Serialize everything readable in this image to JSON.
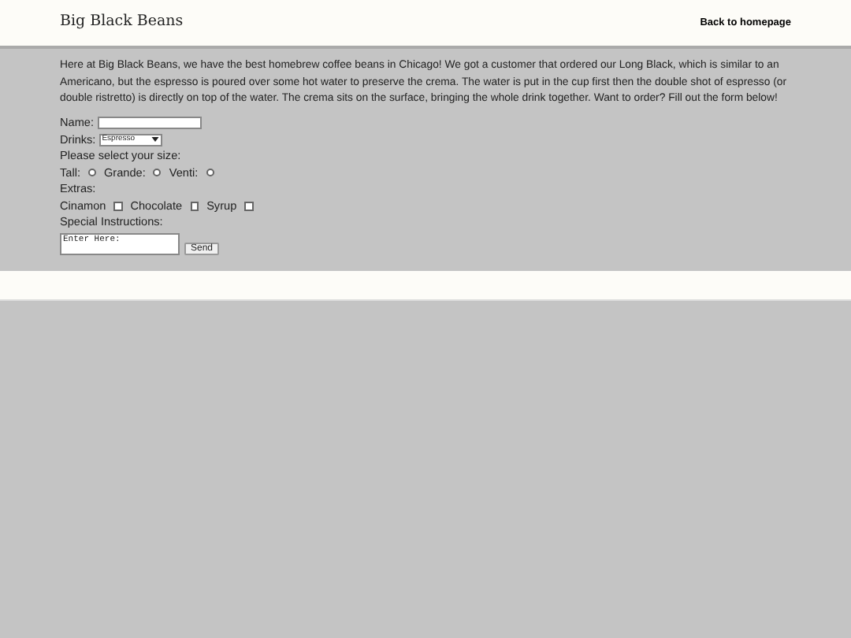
{
  "header": {
    "title": "Big Black Beans",
    "link": "Back to homepage"
  },
  "intro": "Here at Big Black Beans, we have the best homebrew coffee beans in Chicago! We got a customer that ordered our Long Black, which is similar to an Americano, but the espresso is poured over some hot water to preserve the crema. The water is put in the cup first then the double shot of espresso (or double ristretto) is directly on top of the water. The crema sits on the surface, bringing the whole drink together. Want to order? Fill out the form below!",
  "form": {
    "rows": [
      {
        "kind": "text",
        "label": "Name:"
      },
      {
        "kind": "select",
        "label": "Drinks:",
        "value": "Espresso"
      },
      {
        "kind": "heading",
        "label": "Please select your size:"
      },
      {
        "kind": "radios",
        "options": [
          {
            "label": "Tall:",
            "selected": false
          },
          {
            "label": "Grande:",
            "selected": false
          },
          {
            "label": "Venti:",
            "selected": false
          }
        ]
      },
      {
        "kind": "heading",
        "label": "Extras:"
      },
      {
        "kind": "checks",
        "options": [
          {
            "label": "Cinamon",
            "checked": false
          },
          {
            "label": "Chocolate",
            "checked": false
          },
          {
            "label": "Syrup",
            "checked": false
          }
        ]
      },
      {
        "kind": "heading",
        "label": "Special Instructions:"
      },
      {
        "kind": "textarea",
        "value": "Enter Here:",
        "button": "Send"
      }
    ]
  }
}
